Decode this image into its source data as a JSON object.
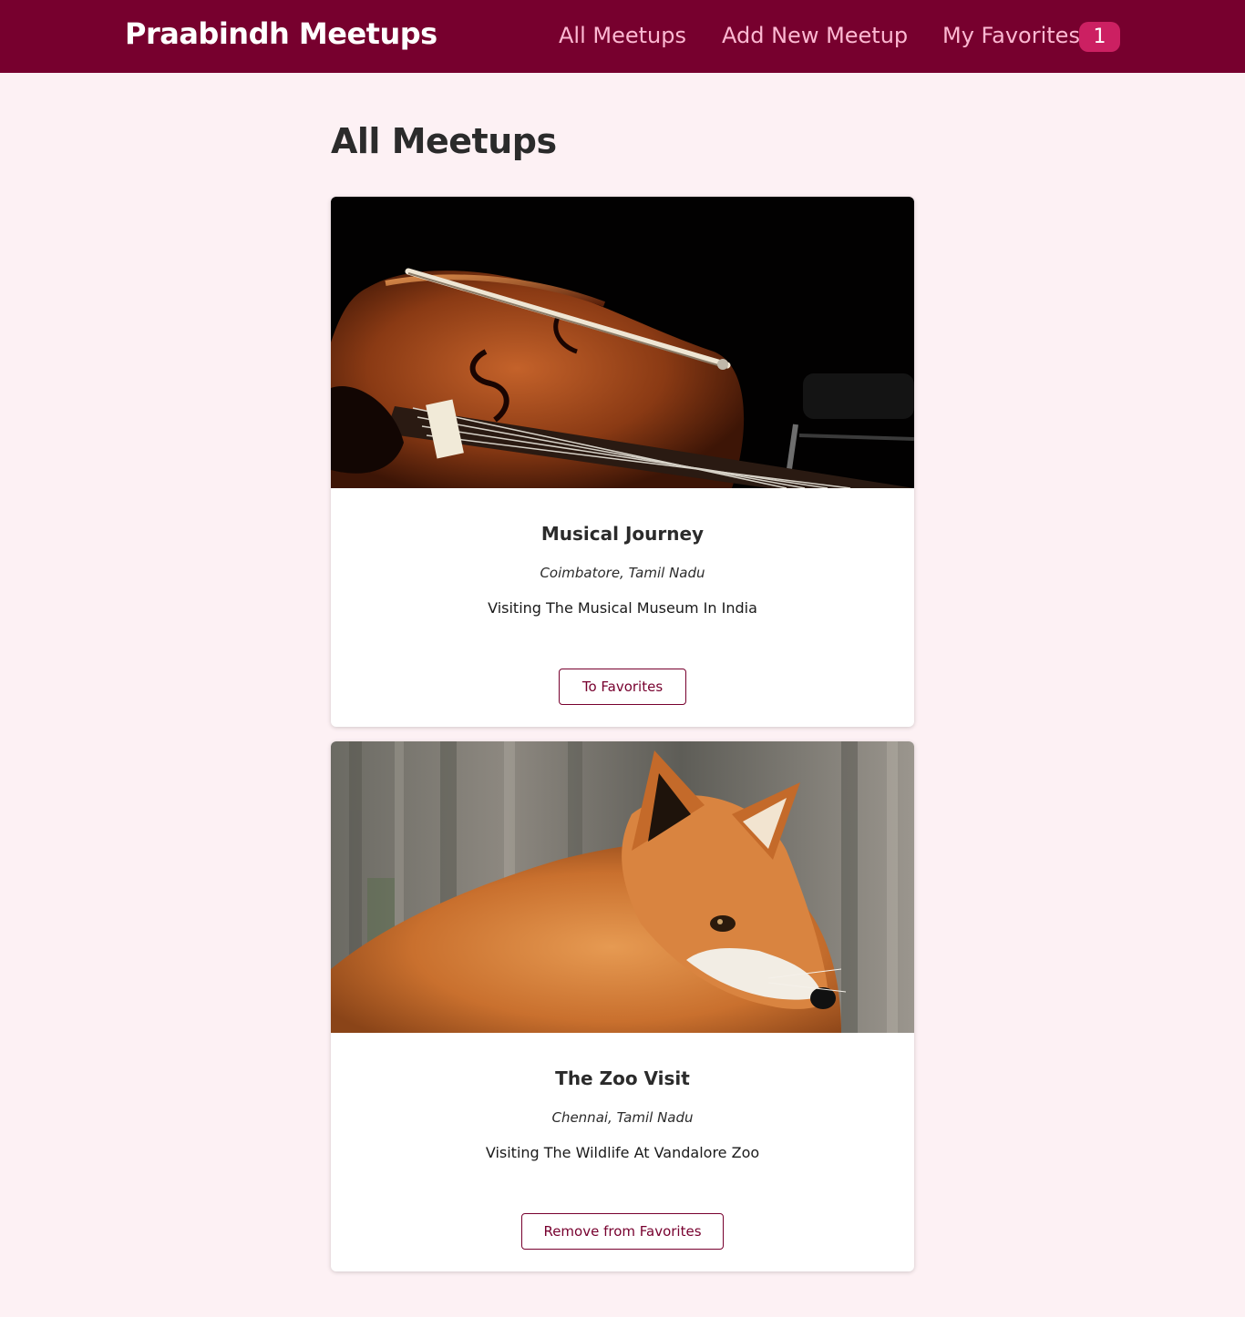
{
  "header": {
    "logo": "Praabindh Meetups",
    "nav": {
      "all_meetups": "All Meetups",
      "add_new_meetup": "Add New Meetup",
      "my_favorites": "My Favorites",
      "favorites_count": "1"
    }
  },
  "main": {
    "page_title": "All Meetups",
    "meetups": [
      {
        "image": "cello-image",
        "title": "Musical Journey",
        "address": "Coimbatore, Tamil Nadu",
        "description": "Visiting The Musical Museum In India",
        "button_label": "To Favorites"
      },
      {
        "image": "fox-image",
        "title": "The Zoo Visit",
        "address": "Chennai, Tamil Nadu",
        "description": "Visiting The Wildlife At Vandalore Zoo",
        "button_label": "Remove from Favorites"
      }
    ]
  },
  "colors": {
    "header_bg": "#77002e",
    "nav_link": "#fcb8d2",
    "badge_bg": "#cc2062",
    "page_bg": "#fdf1f4",
    "button_border": "#77002e"
  }
}
